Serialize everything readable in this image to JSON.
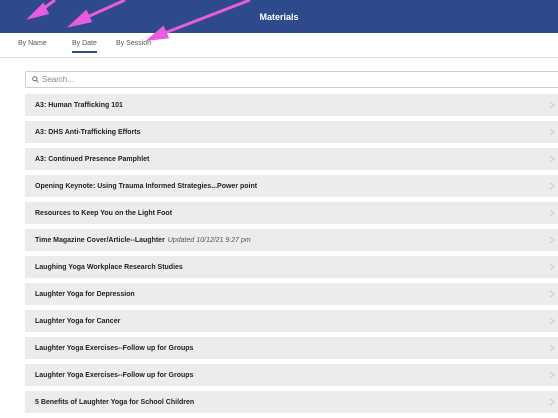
{
  "header": {
    "title": "Materials"
  },
  "tabs": [
    {
      "label": "By Name",
      "active": false
    },
    {
      "label": "By Date",
      "active": true
    },
    {
      "label": "By Session",
      "active": false
    }
  ],
  "search": {
    "placeholder": "Search..."
  },
  "items": [
    {
      "title": "A3: Human Trafficking 101",
      "note": ""
    },
    {
      "title": "A3: DHS Anti-Trafficking Efforts",
      "note": ""
    },
    {
      "title": "A3: Continued Presence Pamphlet",
      "note": ""
    },
    {
      "title": "Opening Keynote: Using Trauma Informed Strategies...Power point",
      "note": ""
    },
    {
      "title": "Resources to Keep You on the Light Foot",
      "note": ""
    },
    {
      "title": "Time Magazine Cover/Article--Laughter",
      "note": "Updated 10/12/21 9:27 pm"
    },
    {
      "title": "Laughing Yoga Workplace Research Studies",
      "note": ""
    },
    {
      "title": "Laughter Yoga for Depression",
      "note": ""
    },
    {
      "title": "Laughter Yoga for Cancer",
      "note": ""
    },
    {
      "title": "Laughter Yoga Exercises--Follow up for Groups",
      "note": ""
    },
    {
      "title": "Laughter Yoga Exercises--Follow up for Groups",
      "note": ""
    },
    {
      "title": "5 Benefits of Laughter Yoga for School Children",
      "note": ""
    }
  ],
  "colors": {
    "header_bg": "#2e4a8c",
    "row_bg": "#ececec",
    "annotation_arrow": "#e85ce0"
  }
}
